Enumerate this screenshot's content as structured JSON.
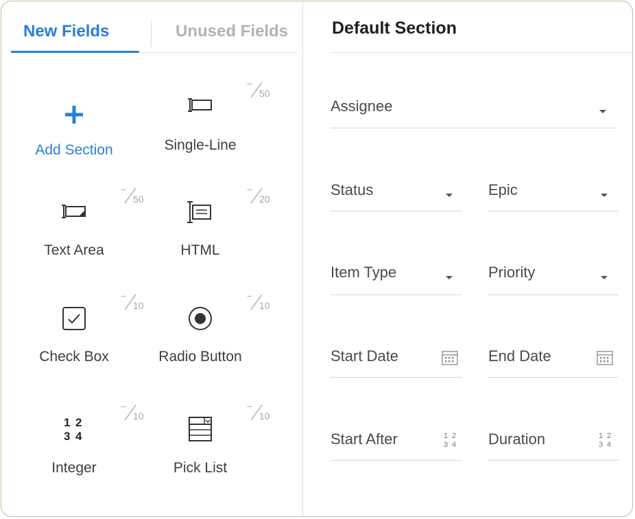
{
  "tabs": {
    "new": "New Fields",
    "unused": "Unused Fields"
  },
  "palette": {
    "add_section": "Add Section",
    "items": [
      {
        "label": "Single-Line",
        "limit": "50",
        "icon": "single-line-icon"
      },
      {
        "label": "Text Area",
        "limit": "50",
        "icon": "text-area-icon"
      },
      {
        "label": "HTML",
        "limit": "20",
        "icon": "html-icon"
      },
      {
        "label": "Check Box",
        "limit": "10",
        "icon": "checkbox-icon"
      },
      {
        "label": "Radio Button",
        "limit": "10",
        "icon": "radio-button-icon"
      },
      {
        "label": "Integer",
        "limit": "10",
        "icon": "integer-icon"
      },
      {
        "label": "Pick List",
        "limit": "10",
        "icon": "pick-list-icon"
      }
    ],
    "limit_dash": "--",
    "integer_digits": [
      "1",
      "2",
      "3",
      "4"
    ]
  },
  "layout_section": {
    "title": "Default Section",
    "fields": [
      {
        "label": "Assignee",
        "control": "dropdown"
      },
      {
        "label": "Status",
        "control": "dropdown"
      },
      {
        "label": "Epic",
        "control": "dropdown"
      },
      {
        "label": "Item Type",
        "control": "dropdown"
      },
      {
        "label": "Priority",
        "control": "dropdown"
      },
      {
        "label": "Start Date",
        "control": "date"
      },
      {
        "label": "End Date",
        "control": "date"
      },
      {
        "label": "Start After",
        "control": "number"
      },
      {
        "label": "Duration",
        "control": "number"
      }
    ],
    "number_digits": [
      "1",
      "2",
      "3",
      "4"
    ]
  },
  "colors": {
    "accent": "#2a7fd4",
    "inactive_tab": "#b3b3b3",
    "border": "#c9b89a"
  }
}
